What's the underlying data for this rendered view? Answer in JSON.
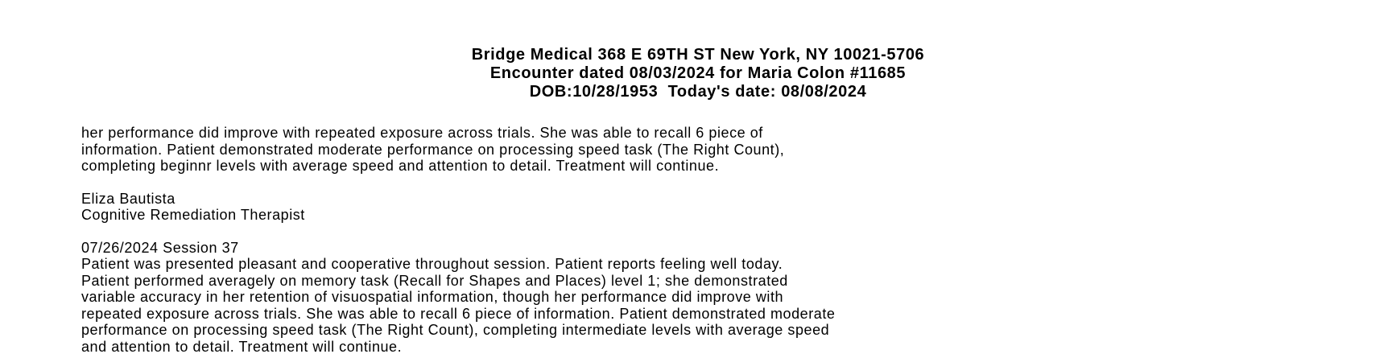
{
  "header": {
    "line1": "Bridge Medical 368 E 69TH ST New York, NY 10021-5706",
    "line2": "Encounter dated 08/03/2024 for Maria Colon #11685",
    "line3": "DOB:10/28/1953  Today's date: 08/08/2024"
  },
  "note1": {
    "lines": [
      "her performance did improve with repeated exposure across trials. She was able to recall 6 piece of",
      "information. Patient demonstrated moderate performance on processing speed task (The Right Count),",
      "completing beginnr levels with average speed and attention to detail. Treatment will continue."
    ]
  },
  "signature": {
    "name": "Eliza Bautista",
    "title": "Cognitive Remediation Therapist"
  },
  "session": {
    "heading": "07/26/2024 Session 37",
    "lines": [
      "Patient was presented pleasant and cooperative throughout session. Patient reports feeling well today.",
      "Patient performed averagely on memory task (Recall for Shapes and Places) level 1; she demonstrated",
      "variable accuracy in her retention of visuospatial information, though her performance did improve with",
      "repeated exposure across trials. She was able to recall 6 piece of information. Patient demonstrated moderate",
      "performance on processing speed task (The Right Count), completing intermediate levels with average speed",
      "and attention to detail. Treatment will continue."
    ]
  }
}
